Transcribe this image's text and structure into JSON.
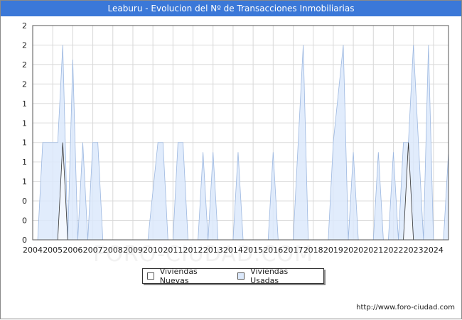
{
  "header": {
    "title": "Leaburu - Evolucion del Nº de Transacciones Inmobiliarias"
  },
  "watermark": "FORO-CIUDAD.COM",
  "footer": {
    "source": "http://www.foro-ciudad.com"
  },
  "legend": [
    {
      "label": "Viviendas Nuevas",
      "color": "#ffffff"
    },
    {
      "label": "Viviendas Usadas",
      "color": "#dce9fb"
    }
  ],
  "chart_data": {
    "type": "area",
    "title": "Leaburu - Evolucion del Nº de Transacciones Inmobiliarias",
    "xlabel": "",
    "ylabel": "",
    "x_tick_labels": [
      "2004",
      "2005",
      "2006",
      "2007",
      "2008",
      "2009",
      "2010",
      "2011",
      "2012",
      "2013",
      "2014",
      "2015",
      "2016",
      "2017",
      "2018",
      "2019",
      "2020",
      "2021",
      "2022",
      "2023",
      "2024"
    ],
    "y_tick_labels": [
      "0",
      "0",
      "0",
      "1",
      "1",
      "1",
      "1",
      "1",
      "2",
      "2",
      "2",
      "2"
    ],
    "xlim": [
      2004,
      2024.75
    ],
    "ylim": [
      0,
      2.2
    ],
    "grid": true,
    "legend_position": "bottom",
    "series": [
      {
        "name": "Viviendas Nuevas",
        "color": "#ffffff",
        "stroke": "#333333",
        "points": [
          [
            2004.0,
            0
          ],
          [
            2005.25,
            0
          ],
          [
            2005.5,
            1
          ],
          [
            2005.75,
            0
          ],
          [
            2022.5,
            0
          ],
          [
            2022.75,
            1
          ],
          [
            2023.0,
            0
          ],
          [
            2024.75,
            0
          ]
        ]
      },
      {
        "name": "Viviendas Usadas",
        "color": "#dce9fb",
        "stroke": "#9db8e0",
        "points": [
          [
            2004.0,
            0
          ],
          [
            2004.25,
            0
          ],
          [
            2004.5,
            1
          ],
          [
            2004.75,
            1
          ],
          [
            2005.0,
            1
          ],
          [
            2005.25,
            1
          ],
          [
            2005.5,
            2
          ],
          [
            2005.75,
            0
          ],
          [
            2006.0,
            1.85
          ],
          [
            2006.25,
            0
          ],
          [
            2006.5,
            1
          ],
          [
            2006.75,
            0
          ],
          [
            2007.0,
            1
          ],
          [
            2007.25,
            1
          ],
          [
            2007.5,
            0
          ],
          [
            2009.75,
            0
          ],
          [
            2010.25,
            1
          ],
          [
            2010.5,
            1
          ],
          [
            2010.75,
            0
          ],
          [
            2011.0,
            0
          ],
          [
            2011.25,
            1
          ],
          [
            2011.5,
            1
          ],
          [
            2011.75,
            0
          ],
          [
            2012.25,
            0
          ],
          [
            2012.5,
            0.9
          ],
          [
            2012.75,
            0
          ],
          [
            2013.0,
            0.9
          ],
          [
            2013.25,
            0
          ],
          [
            2014.0,
            0
          ],
          [
            2014.25,
            0.9
          ],
          [
            2014.5,
            0
          ],
          [
            2015.75,
            0
          ],
          [
            2016.0,
            0.9
          ],
          [
            2016.25,
            0
          ],
          [
            2017.0,
            0
          ],
          [
            2017.5,
            2
          ],
          [
            2017.75,
            0
          ],
          [
            2018.75,
            0
          ],
          [
            2019.0,
            1
          ],
          [
            2019.5,
            2
          ],
          [
            2019.75,
            0
          ],
          [
            2020.0,
            0.9
          ],
          [
            2020.25,
            0
          ],
          [
            2021.0,
            0
          ],
          [
            2021.25,
            0.9
          ],
          [
            2021.5,
            0
          ],
          [
            2021.75,
            0
          ],
          [
            2022.0,
            0.9
          ],
          [
            2022.25,
            0
          ],
          [
            2022.5,
            1
          ],
          [
            2022.75,
            1
          ],
          [
            2023.0,
            2
          ],
          [
            2023.25,
            1
          ],
          [
            2023.5,
            0
          ],
          [
            2023.75,
            2
          ],
          [
            2024.0,
            0
          ],
          [
            2024.25,
            0
          ],
          [
            2024.5,
            0
          ],
          [
            2024.75,
            0.9
          ]
        ]
      }
    ]
  }
}
